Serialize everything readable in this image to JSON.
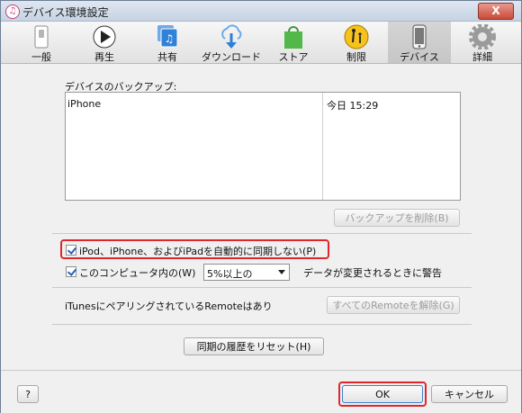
{
  "window": {
    "title": "デバイス環境設定",
    "close_label": "X"
  },
  "toolbar": {
    "items": [
      {
        "label": "一般",
        "icon": "switch-icon"
      },
      {
        "label": "再生",
        "icon": "play-icon"
      },
      {
        "label": "共有",
        "icon": "share-icon"
      },
      {
        "label": "ダウンロード",
        "icon": "download-icon"
      },
      {
        "label": "ストア",
        "icon": "store-bag-icon"
      },
      {
        "label": "制限",
        "icon": "parental-icon"
      },
      {
        "label": "デバイス",
        "icon": "phone-icon"
      },
      {
        "label": "詳細",
        "icon": "gear-icon"
      }
    ],
    "active": "デバイス"
  },
  "backups": {
    "label": "デバイスのバックアップ:",
    "rows": [
      {
        "name": "iPhone",
        "time": "今日 15:29"
      }
    ],
    "delete_button": "バックアップを削除(B)"
  },
  "options": {
    "prevent_sync_label": "iPod、iPhone、およびiPadを自動的に同期しない(P)",
    "prevent_sync_checked": true,
    "warn_label_prefix": "このコンピュータ内の(W)",
    "warn_select_value": "5%以上の",
    "warn_label_suffix": "データが変更されるときに警告",
    "warn_checked": true
  },
  "remote": {
    "label": "iTunesにペアリングされているRemoteはあり",
    "forget_button": "すべてのRemoteを解除(G)"
  },
  "reset_sync_button": "同期の履歴をリセット(H)",
  "footer": {
    "help_label": "?",
    "ok_label": "OK",
    "cancel_label": "キャンセル"
  },
  "colors": {
    "highlight": "#e0262c",
    "accent": "#2a5fb8"
  }
}
